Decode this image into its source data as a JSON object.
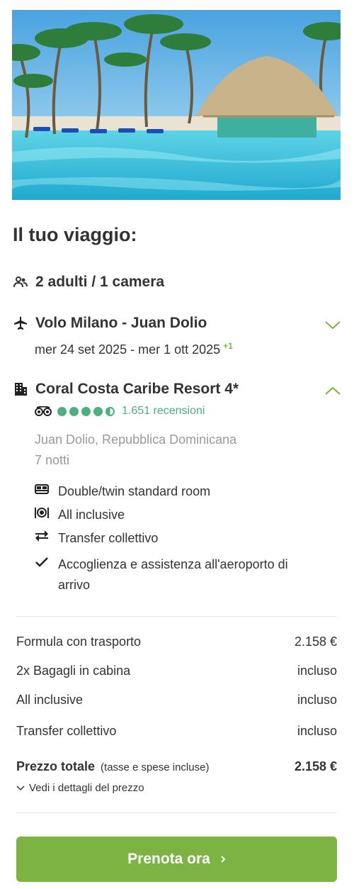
{
  "trip": {
    "title": "Il tuo viaggio:",
    "guests": "2 adulti / 1 camera",
    "flight": {
      "title": "Volo Milano - Juan Dolio",
      "dates": "mer 24 set 2025 - mer 1 ott 2025",
      "day_offset": "+1"
    },
    "hotel": {
      "name": "Coral Costa Caribe Resort 4*",
      "rating": 4.5,
      "reviews": "1.651 recensioni",
      "location": "Juan Dolio, Repubblica Dominicana",
      "nights": "7 notti",
      "features": [
        {
          "icon": "bed-icon",
          "label": "Double/twin standard room"
        },
        {
          "icon": "dining-icon",
          "label": "All inclusive"
        },
        {
          "icon": "transfer-icon",
          "label": "Transfer collettivo"
        },
        {
          "icon": "check-icon",
          "label": "Accoglienza e assistenza all'aeroporto di arrivo"
        }
      ]
    }
  },
  "pricing": {
    "rows": [
      {
        "label": "Formula con trasporto",
        "value": "2.158 €"
      },
      {
        "label": "2x Bagagli in cabina",
        "value": "incluso"
      },
      {
        "label": "All inclusive",
        "value": "incluso"
      },
      {
        "label": "Transfer collettivo",
        "value": "incluso"
      }
    ],
    "total_label": "Prezzo totale",
    "total_note": "(tasse e spese incluse)",
    "total_value": "2.158 €",
    "details_link": "Vedi i dettagli del prezzo"
  },
  "cta": {
    "label": "Prenota ora"
  },
  "colors": {
    "accent": "#7cb342",
    "rating": "#4caf7d"
  }
}
